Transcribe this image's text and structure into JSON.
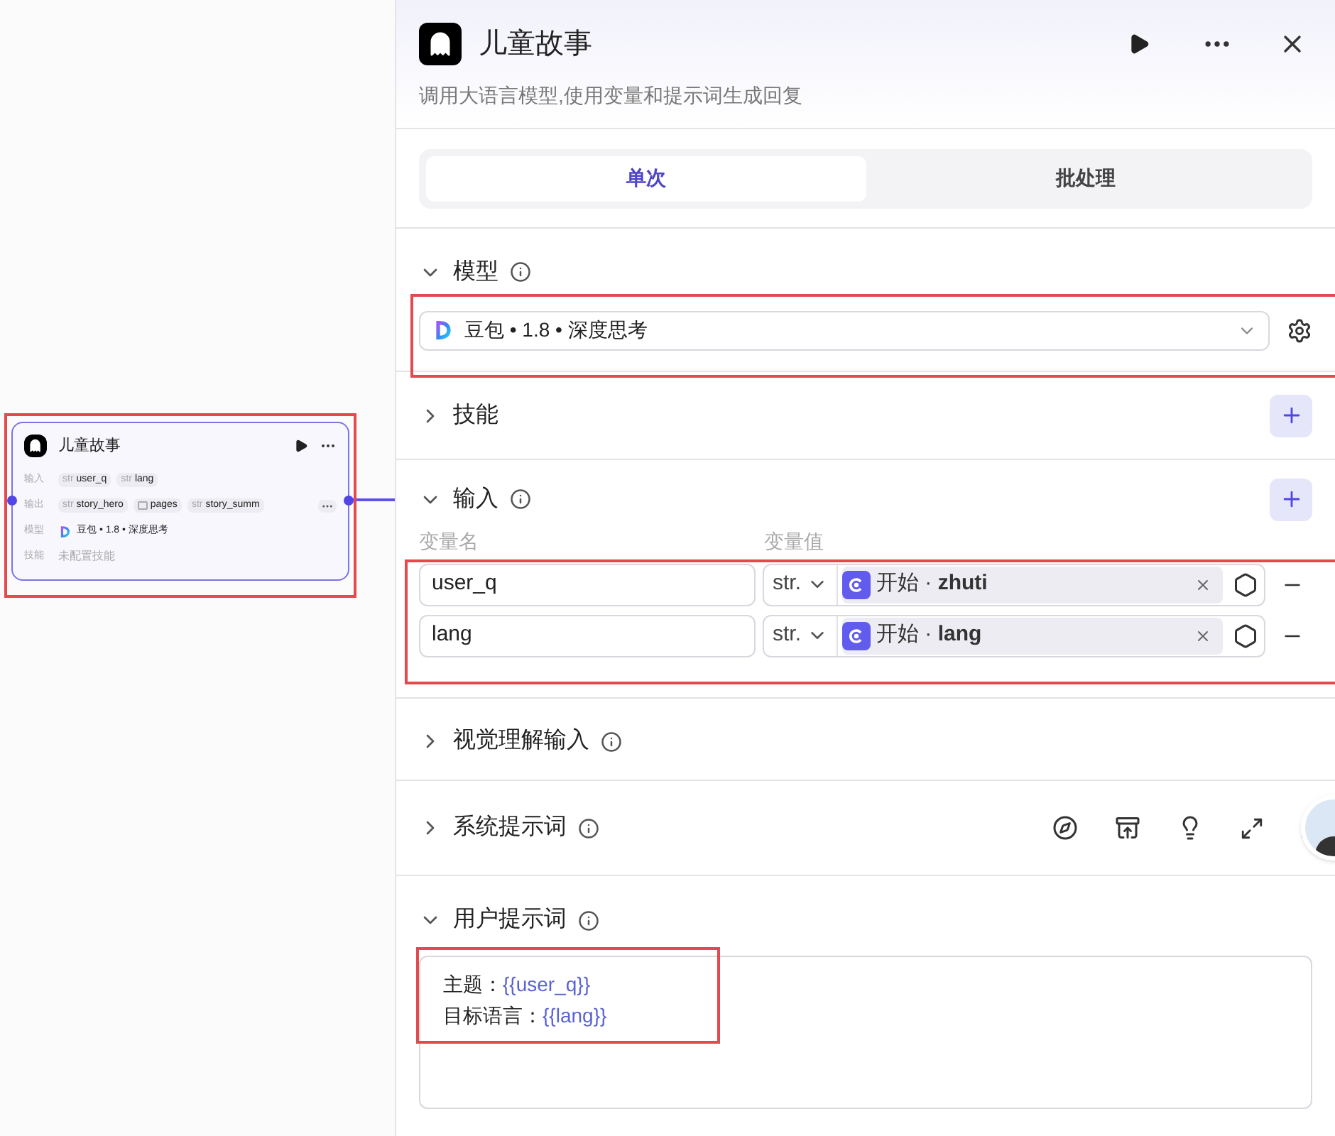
{
  "canvas": {
    "node": {
      "title": "儿童故事",
      "highlighted": true,
      "rows": [
        {
          "kind": "tags",
          "label": "输入",
          "more": false,
          "tags": [
            {
              "kind": "typed",
              "type": "str",
              "name": "user_q"
            },
            {
              "kind": "typed",
              "type": "str",
              "name": "lang"
            }
          ]
        },
        {
          "kind": "tags",
          "label": "输出",
          "more": true,
          "tags": [
            {
              "kind": "typed",
              "type": "str",
              "name": "story_hero"
            },
            {
              "kind": "array",
              "name": "pages"
            },
            {
              "kind": "typed",
              "type": "str",
              "name": "story_summ"
            }
          ]
        },
        {
          "kind": "model",
          "label": "模型",
          "value": "豆包 • 1.8 • 深度思考"
        },
        {
          "kind": "muted",
          "label": "技能",
          "value": "未配置技能"
        }
      ]
    }
  },
  "panel": {
    "title": "儿童故事",
    "description": "调用大语言模型,使用变量和提示词生成回复",
    "tabs": [
      {
        "label": "单次",
        "selected": true
      },
      {
        "label": "批处理",
        "selected": false
      }
    ],
    "sections": [
      {
        "kind": "model",
        "title": "模型",
        "info": true,
        "expanded": true,
        "highlighted": true,
        "value": "豆包 • 1.8 • 深度思考"
      },
      {
        "kind": "skills",
        "title": "技能",
        "info": false,
        "expanded": false
      },
      {
        "kind": "inputs",
        "title": "输入",
        "info": true,
        "expanded": true,
        "highlighted": true,
        "columns": [
          "变量名",
          "变量值"
        ],
        "rows": [
          {
            "name": "user_q",
            "type": "str.",
            "ref": "开始 · **zhuti**"
          },
          {
            "name": "lang",
            "type": "str.",
            "ref": "开始 · **lang**"
          }
        ]
      },
      {
        "kind": "vision",
        "title": "视觉理解输入",
        "info": true,
        "expanded": false
      },
      {
        "kind": "system_prompt",
        "title": "系统提示词",
        "info": true,
        "expanded": false
      },
      {
        "kind": "user_prompt",
        "title": "用户提示词",
        "info": true,
        "expanded": true,
        "highlighted": true,
        "lines": [
          {
            "label": "主题：",
            "variable": "{{user_q}}"
          },
          {
            "label": "目标语言：",
            "variable": "{{lang}}"
          }
        ]
      }
    ]
  }
}
